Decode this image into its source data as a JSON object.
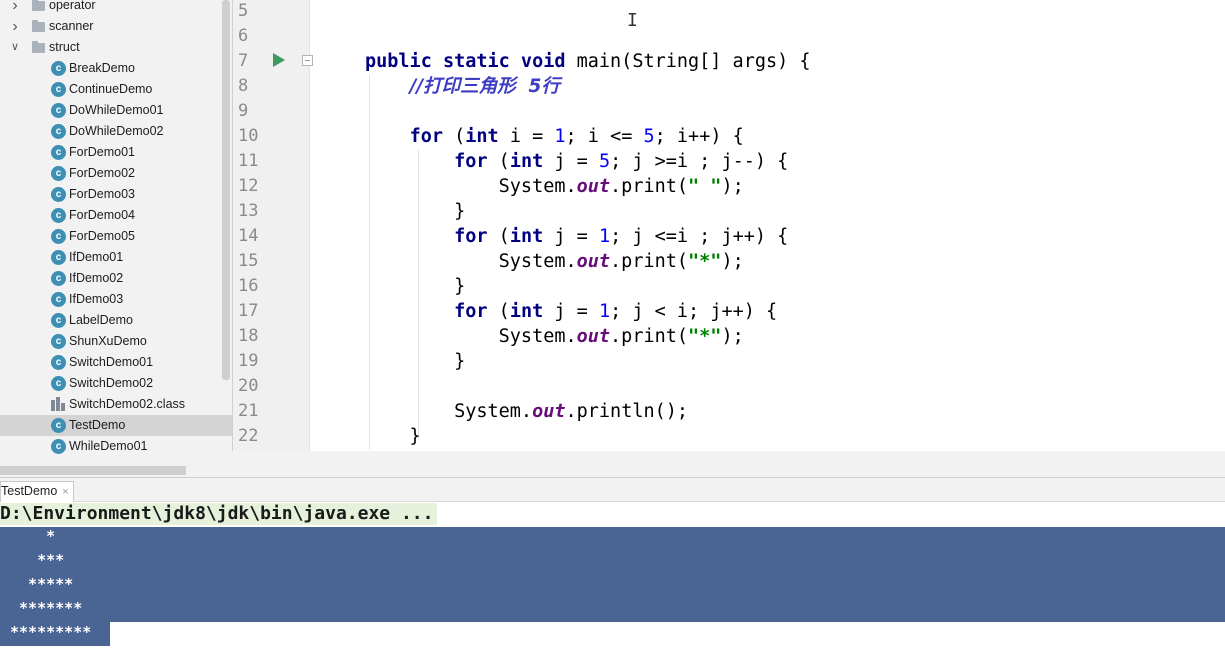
{
  "project_tree": {
    "items": [
      {
        "label": "operator",
        "type": "folder",
        "expanded": false
      },
      {
        "label": "scanner",
        "type": "folder",
        "expanded": false
      },
      {
        "label": "struct",
        "type": "folder",
        "expanded": true
      },
      {
        "label": "BreakDemo",
        "type": "class"
      },
      {
        "label": "ContinueDemo",
        "type": "class"
      },
      {
        "label": "DoWhileDemo01",
        "type": "class"
      },
      {
        "label": "DoWhileDemo02",
        "type": "class"
      },
      {
        "label": "ForDemo01",
        "type": "class"
      },
      {
        "label": "ForDemo02",
        "type": "class"
      },
      {
        "label": "ForDemo03",
        "type": "class"
      },
      {
        "label": "ForDemo04",
        "type": "class"
      },
      {
        "label": "ForDemo05",
        "type": "class"
      },
      {
        "label": "IfDemo01",
        "type": "class"
      },
      {
        "label": "IfDemo02",
        "type": "class"
      },
      {
        "label": "IfDemo03",
        "type": "class"
      },
      {
        "label": "LabelDemo",
        "type": "class"
      },
      {
        "label": "ShunXuDemo",
        "type": "class"
      },
      {
        "label": "SwitchDemo01",
        "type": "class"
      },
      {
        "label": "SwitchDemo02",
        "type": "class"
      },
      {
        "label": "SwitchDemo02.class",
        "type": "classfile"
      },
      {
        "label": "TestDemo",
        "type": "class",
        "selected": true
      },
      {
        "label": "WhileDemo01",
        "type": "class"
      }
    ],
    "class_icon_letter": "c"
  },
  "editor": {
    "line_numbers": [
      "5",
      "6",
      "7",
      "8",
      "9",
      "10",
      "11",
      "12",
      "13",
      "14",
      "15",
      "16",
      "17",
      "18",
      "19",
      "20",
      "21",
      "22"
    ],
    "lines": [
      [],
      [],
      [
        {
          "t": "kw",
          "v": "public static void "
        },
        {
          "t": "p",
          "v": "main(String[] args) {"
        }
      ],
      [
        {
          "t": "p",
          "v": "    "
        },
        {
          "t": "cmt",
          "v": "//打印三角形  5行"
        }
      ],
      [],
      [
        {
          "t": "p",
          "v": "    "
        },
        {
          "t": "kw",
          "v": "for "
        },
        {
          "t": "p",
          "v": "("
        },
        {
          "t": "kw",
          "v": "int "
        },
        {
          "t": "p",
          "v": "i = "
        },
        {
          "t": "num",
          "v": "1"
        },
        {
          "t": "p",
          "v": "; i <= "
        },
        {
          "t": "num",
          "v": "5"
        },
        {
          "t": "p",
          "v": "; i++) {"
        }
      ],
      [
        {
          "t": "p",
          "v": "        "
        },
        {
          "t": "kw",
          "v": "for "
        },
        {
          "t": "p",
          "v": "("
        },
        {
          "t": "kw",
          "v": "int "
        },
        {
          "t": "p",
          "v": "j = "
        },
        {
          "t": "num",
          "v": "5"
        },
        {
          "t": "p",
          "v": "; j >=i ; j--) {"
        }
      ],
      [
        {
          "t": "p",
          "v": "            System."
        },
        {
          "t": "fld",
          "v": "out"
        },
        {
          "t": "p",
          "v": ".print("
        },
        {
          "t": "str",
          "v": "\" \""
        },
        {
          "t": "p",
          "v": ");"
        }
      ],
      [
        {
          "t": "p",
          "v": "        }"
        }
      ],
      [
        {
          "t": "p",
          "v": "        "
        },
        {
          "t": "kw",
          "v": "for "
        },
        {
          "t": "p",
          "v": "("
        },
        {
          "t": "kw",
          "v": "int "
        },
        {
          "t": "p",
          "v": "j = "
        },
        {
          "t": "num",
          "v": "1"
        },
        {
          "t": "p",
          "v": "; j <=i ; j++) {"
        }
      ],
      [
        {
          "t": "p",
          "v": "            System."
        },
        {
          "t": "fld",
          "v": "out"
        },
        {
          "t": "p",
          "v": ".print("
        },
        {
          "t": "str",
          "v": "\"*\""
        },
        {
          "t": "p",
          "v": ");"
        }
      ],
      [
        {
          "t": "p",
          "v": "        }"
        }
      ],
      [
        {
          "t": "p",
          "v": "        "
        },
        {
          "t": "kw",
          "v": "for "
        },
        {
          "t": "p",
          "v": "("
        },
        {
          "t": "kw",
          "v": "int "
        },
        {
          "t": "p",
          "v": "j = "
        },
        {
          "t": "num",
          "v": "1"
        },
        {
          "t": "p",
          "v": "; j < i; j++) {"
        }
      ],
      [
        {
          "t": "p",
          "v": "            System."
        },
        {
          "t": "fld",
          "v": "out"
        },
        {
          "t": "p",
          "v": ".print("
        },
        {
          "t": "str",
          "v": "\"*\""
        },
        {
          "t": "p",
          "v": ");"
        }
      ],
      [
        {
          "t": "p",
          "v": "        }"
        }
      ],
      [],
      [
        {
          "t": "p",
          "v": "        System."
        },
        {
          "t": "fld",
          "v": "out"
        },
        {
          "t": "p",
          "v": ".println();"
        }
      ],
      [
        {
          "t": "p",
          "v": "    }"
        }
      ]
    ],
    "text_cursor_glyph": "I"
  },
  "run_panel": {
    "tab_label": "TestDemo",
    "tab_close": "×",
    "command": "D:\\Environment\\jdk8\\jdk\\bin\\java.exe ...",
    "output_lines": [
      "    *",
      "   ***",
      "  *****",
      " *******",
      "*********"
    ]
  },
  "colors": {
    "keyword": "#000080",
    "number": "#0000ff",
    "string": "#008000",
    "field": "#660e7a",
    "comment": "#3d3dc4",
    "selection": "#4a6594",
    "run_icon": "#3c9a5f"
  }
}
